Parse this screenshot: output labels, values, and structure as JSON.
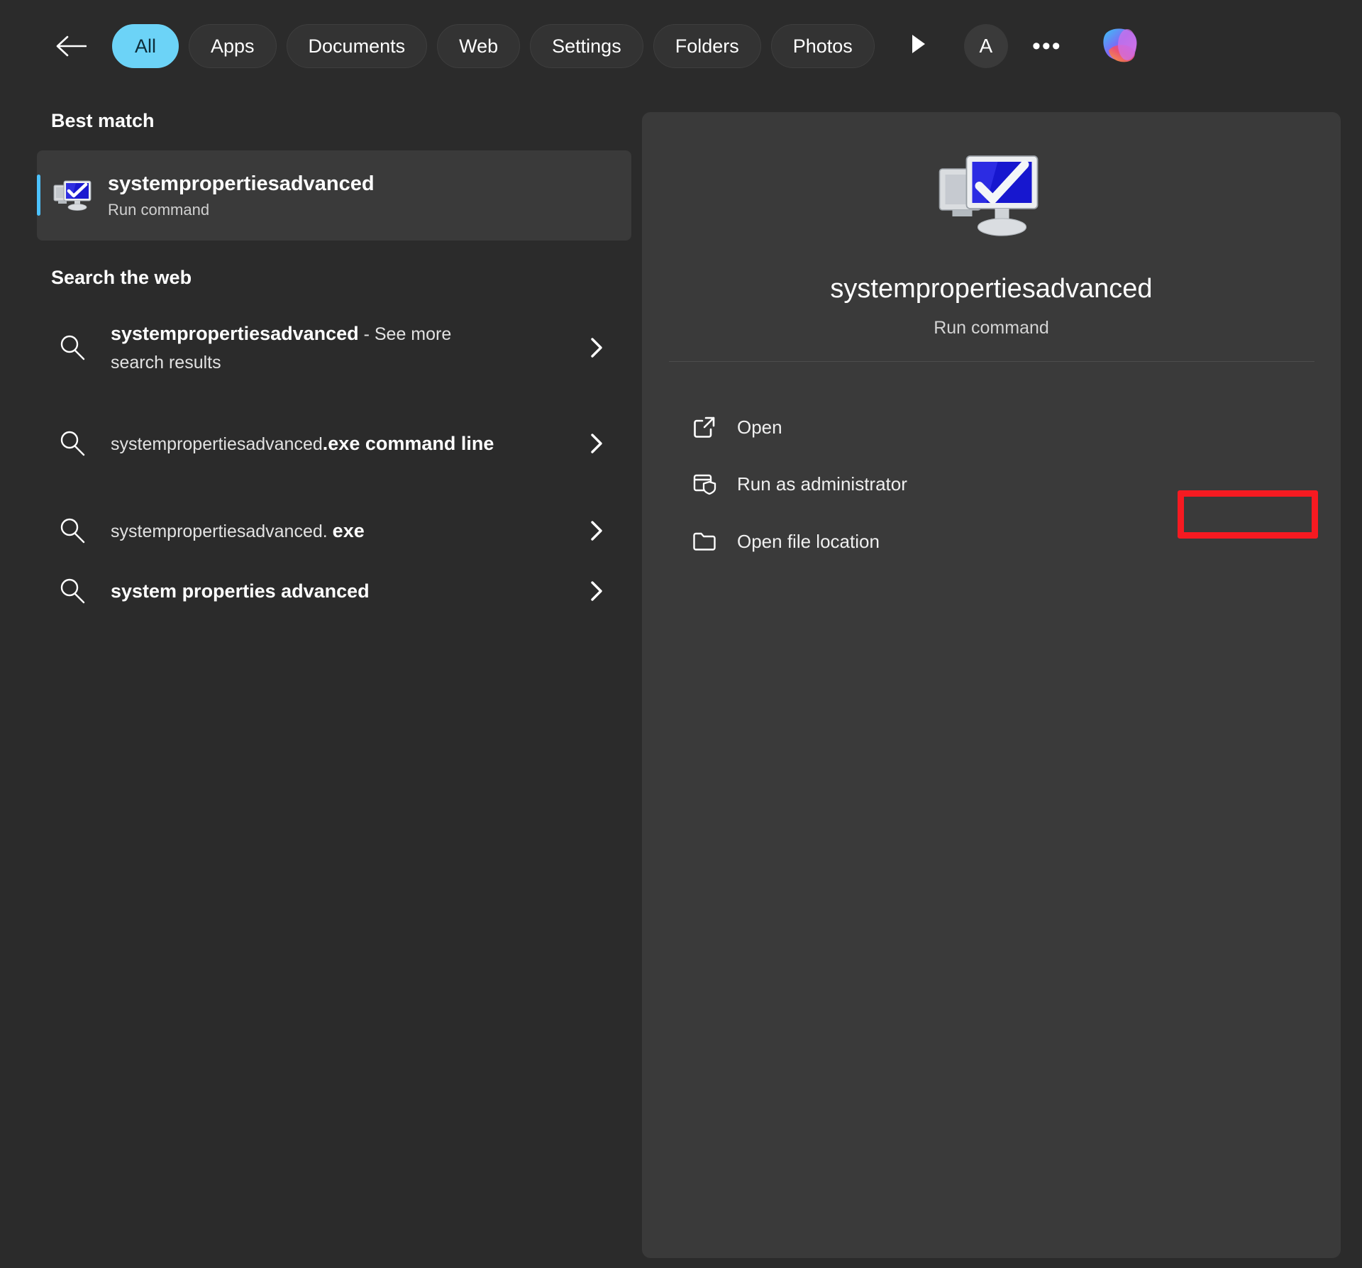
{
  "window": {
    "title": "Windows Search",
    "background": "#2b2b2b",
    "panel_background": "#3a3a3a",
    "accent": "#6cd3f7",
    "selection_bar": "#4cc2ff",
    "highlight_color": "#f61a21"
  },
  "tabbar": {
    "back_icon": "back-arrow-icon",
    "tabs": [
      {
        "label": "All",
        "active": true
      },
      {
        "label": "Apps",
        "active": false
      },
      {
        "label": "Documents",
        "active": false
      },
      {
        "label": "Web",
        "active": false
      },
      {
        "label": "Settings",
        "active": false
      },
      {
        "label": "Folders",
        "active": false
      },
      {
        "label": "Photos",
        "active": false
      }
    ],
    "more_arrow_icon": "play-triangle-icon",
    "account_label": "A",
    "overflow_label": "•••",
    "copilot_icon": "copilot-icon"
  },
  "left": {
    "best_match_header": "Best match",
    "best_match": {
      "title": "systempropertiesadvanced",
      "subtitle": "Run command",
      "icon": "system-properties-icon",
      "selected": true
    },
    "search_web_header": "Search the web",
    "web_results": [
      {
        "bold": "systempropertiesadvanced",
        "normal": " - See more search results",
        "full_text": "systempropertiesadvanced - See more search results",
        "icon": "search-icon",
        "chevron": "chevron-right-icon"
      },
      {
        "bold_first": false,
        "normal": "systempropertiesadvanced",
        "bold": ".exe command line",
        "full_text": "systempropertiesadvanced.exe command line",
        "icon": "search-icon",
        "chevron": "chevron-right-icon"
      },
      {
        "bold_first": false,
        "normal": "systempropertiesadvanced. ",
        "bold": "exe",
        "full_text": "systempropertiesadvanced. exe",
        "icon": "search-icon",
        "chevron": "chevron-right-icon"
      },
      {
        "bold_first": true,
        "bold": "system properties advanced",
        "normal": "",
        "full_text": "system properties advanced",
        "icon": "search-icon",
        "chevron": "chevron-right-icon"
      }
    ]
  },
  "preview": {
    "icon": "system-properties-icon",
    "title": "systempropertiesadvanced",
    "subtitle": "Run command",
    "actions": [
      {
        "label": "Open",
        "icon": "external-link-icon",
        "highlighted": true
      },
      {
        "label": "Run as administrator",
        "icon": "shield-window-icon",
        "highlighted": false
      },
      {
        "label": "Open file location",
        "icon": "folder-icon",
        "highlighted": false
      }
    ]
  }
}
